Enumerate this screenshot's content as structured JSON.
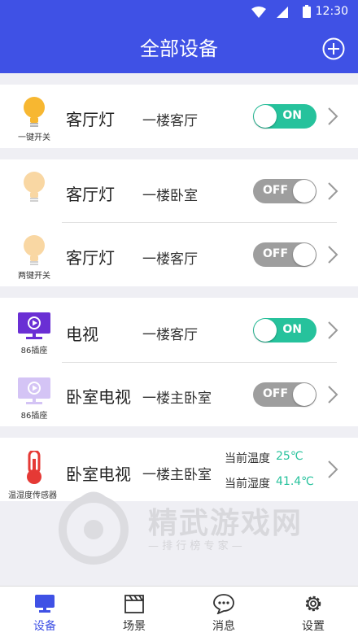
{
  "status_bar": {
    "time": "12:30"
  },
  "header": {
    "title": "全部设备"
  },
  "devices": [
    {
      "name": "客厅灯",
      "location": "一楼客厅",
      "icon": "lightbulb-icon",
      "caption": "一键开关",
      "switch": "ON"
    },
    {
      "name": "客厅灯",
      "location": "一楼卧室",
      "icon": "lightbulb-icon",
      "caption": "",
      "switch": "OFF"
    },
    {
      "name": "客厅灯",
      "location": "一楼客厅",
      "icon": "lightbulb-icon",
      "caption": "两键开关",
      "switch": "OFF"
    },
    {
      "name": "电视",
      "location": "一楼客厅",
      "icon": "tv-icon",
      "caption": "86插座",
      "switch": "ON"
    },
    {
      "name": "卧室电视",
      "location": "一楼主卧室",
      "icon": "tv-icon",
      "caption": "86插座",
      "switch": "OFF"
    },
    {
      "name": "卧室电视",
      "location": "一楼主卧室",
      "icon": "thermometer-icon",
      "caption": "温湿度传感器",
      "temp_label": "当前温度",
      "temp_value": "25℃",
      "humidity_label": "当前湿度",
      "humidity_value": "41.4℃"
    }
  ],
  "watermark": {
    "text": "精武游戏网",
    "subtext": "— 排 行 榜 专 家 —"
  },
  "tabs": [
    {
      "label": "设备",
      "icon": "monitor-icon",
      "active": true
    },
    {
      "label": "场景",
      "icon": "clapperboard-icon",
      "active": false
    },
    {
      "label": "消息",
      "icon": "chat-bubble-icon",
      "active": false
    },
    {
      "label": "设置",
      "icon": "gear-icon",
      "active": false
    }
  ],
  "colors": {
    "primary": "#3F51E5",
    "toggle_on": "#26c29c",
    "toggle_off": "#9e9e9e",
    "bulb_on": "#f7b731",
    "bulb_off": "#f9d7a3",
    "sensor_value": "#26c29c"
  }
}
